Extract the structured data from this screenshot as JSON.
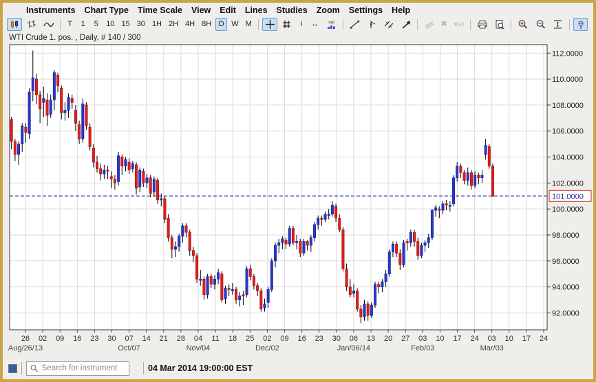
{
  "menubar": {
    "items": [
      "Instruments",
      "Chart Type",
      "Time Scale",
      "View",
      "Edit",
      "Lines",
      "Studies",
      "Zoom",
      "Settings",
      "Help"
    ]
  },
  "toolbar": {
    "timeframes": [
      {
        "label": "T",
        "selected": false
      },
      {
        "label": "1",
        "selected": false
      },
      {
        "label": "5",
        "selected": false
      },
      {
        "label": "10",
        "selected": false
      },
      {
        "label": "15",
        "selected": false
      },
      {
        "label": "30",
        "selected": false
      },
      {
        "label": "1H",
        "selected": false
      },
      {
        "label": "2H",
        "selected": false
      },
      {
        "label": "4H",
        "selected": false
      },
      {
        "label": "8H",
        "selected": false
      },
      {
        "label": "D",
        "selected": true
      },
      {
        "label": "W",
        "selected": false
      },
      {
        "label": "M",
        "selected": false
      }
    ],
    "info_label": "i",
    "expand_label": "↔",
    "vol_label": "vol",
    "delete_label": "✖",
    "delete_all_x": "✖",
    "delete_all_label": "all"
  },
  "title_bar": {
    "text": "WTI Crude 1. pos. , Daily, # 140 / 300"
  },
  "chart_data": {
    "type": "candlestick",
    "title": "WTI Crude 1. pos. , Daily, # 140 / 300",
    "ylim": [
      90.7,
      112.65
    ],
    "y_ticks": [
      92,
      94,
      96,
      98,
      100,
      102,
      104,
      106,
      108,
      110,
      112
    ],
    "y_tick_decimals": 4,
    "last_price": 101.0,
    "x_ticks": [
      "26",
      "02",
      "09",
      "16",
      "23",
      "30",
      "07",
      "14",
      "21",
      "28",
      "04",
      "11",
      "18",
      "25",
      "02",
      "09",
      "16",
      "23",
      "30",
      "06",
      "13",
      "20",
      "27",
      "03",
      "10",
      "17",
      "24",
      "03",
      "10",
      "17",
      "24"
    ],
    "month_labels": [
      {
        "label": "Aug/26/13",
        "tick": 0
      },
      {
        "label": "Oct/07",
        "tick": 6
      },
      {
        "label": "Nov/04",
        "tick": 10
      },
      {
        "label": "Dec/02",
        "tick": 14
      },
      {
        "label": "Jan/06/14",
        "tick": 19
      },
      {
        "label": "Feb/03",
        "tick": 23
      },
      {
        "label": "Mar/03",
        "tick": 27
      }
    ],
    "candle_fields": [
      "open",
      "high",
      "low",
      "close"
    ],
    "candles": [
      [
        106.9,
        107.1,
        104.6,
        105.2
      ],
      [
        105.2,
        105.4,
        103.7,
        104.2
      ],
      [
        104.2,
        105.2,
        103.4,
        105.0
      ],
      [
        105.0,
        106.6,
        104.4,
        106.4
      ],
      [
        106.3,
        106.6,
        105.1,
        105.9
      ],
      [
        105.8,
        109.3,
        105.4,
        109.0
      ],
      [
        109.1,
        112.2,
        108.3,
        110.1
      ],
      [
        110.0,
        110.4,
        108.1,
        108.8
      ],
      [
        108.8,
        109.1,
        106.6,
        107.7
      ],
      [
        108.2,
        109.4,
        107.1,
        108.5
      ],
      [
        108.4,
        108.9,
        106.4,
        107.2
      ],
      [
        107.3,
        108.8,
        107.0,
        108.4
      ],
      [
        108.4,
        110.7,
        107.6,
        110.5
      ],
      [
        110.3,
        110.5,
        109.0,
        109.5
      ],
      [
        109.3,
        109.5,
        106.9,
        107.4
      ],
      [
        107.4,
        108.2,
        106.8,
        107.6
      ],
      [
        107.6,
        108.9,
        107.0,
        108.6
      ],
      [
        108.5,
        108.8,
        107.7,
        108.2
      ],
      [
        107.6,
        108.0,
        106.0,
        106.6
      ],
      [
        106.5,
        106.8,
        105.0,
        105.4
      ],
      [
        105.4,
        108.5,
        105.1,
        108.1
      ],
      [
        108.0,
        108.2,
        106.1,
        106.4
      ],
      [
        106.3,
        106.6,
        104.5,
        104.8
      ],
      [
        104.7,
        105.0,
        103.2,
        103.6
      ],
      [
        103.6,
        104.1,
        102.8,
        103.1
      ],
      [
        103.1,
        103.5,
        102.2,
        102.7
      ],
      [
        102.7,
        103.4,
        102.3,
        103.0
      ],
      [
        103.0,
        103.3,
        102.3,
        102.9
      ],
      [
        102.5,
        102.9,
        101.6,
        102.3
      ],
      [
        102.3,
        102.6,
        101.5,
        102.0
      ],
      [
        102.1,
        104.4,
        101.8,
        104.1
      ],
      [
        104.0,
        104.2,
        102.6,
        103.3
      ],
      [
        103.3,
        104.0,
        102.9,
        103.8
      ],
      [
        103.6,
        103.9,
        102.7,
        103.0
      ],
      [
        103.1,
        103.7,
        102.8,
        103.5
      ],
      [
        103.4,
        103.6,
        101.1,
        101.6
      ],
      [
        101.7,
        103.2,
        101.3,
        103.0
      ],
      [
        102.9,
        103.1,
        101.7,
        102.0
      ],
      [
        102.0,
        102.7,
        101.6,
        102.4
      ],
      [
        102.4,
        102.6,
        100.9,
        101.2
      ],
      [
        101.3,
        102.5,
        101.0,
        102.3
      ],
      [
        102.2,
        102.4,
        100.4,
        100.7
      ],
      [
        100.7,
        101.2,
        100.2,
        100.8
      ],
      [
        100.8,
        101.0,
        98.9,
        99.2
      ],
      [
        99.3,
        99.6,
        97.5,
        97.8
      ],
      [
        97.8,
        98.0,
        96.2,
        96.9
      ],
      [
        96.9,
        97.5,
        96.3,
        97.1
      ],
      [
        97.1,
        98.1,
        96.7,
        97.9
      ],
      [
        97.9,
        98.9,
        97.4,
        98.7
      ],
      [
        98.7,
        98.9,
        97.8,
        98.2
      ],
      [
        98.2,
        98.4,
        96.4,
        96.8
      ],
      [
        96.8,
        97.1,
        95.9,
        96.4
      ],
      [
        96.4,
        96.6,
        94.3,
        94.6
      ],
      [
        94.5,
        95.3,
        94.1,
        94.6
      ],
      [
        94.6,
        94.8,
        93.0,
        93.4
      ],
      [
        93.4,
        95.0,
        93.1,
        94.8
      ],
      [
        94.8,
        95.0,
        93.9,
        94.2
      ],
      [
        94.2,
        94.9,
        93.8,
        94.6
      ],
      [
        94.6,
        95.4,
        94.2,
        95.1
      ],
      [
        95.0,
        95.2,
        92.8,
        93.0
      ],
      [
        93.1,
        94.1,
        92.7,
        93.9
      ],
      [
        93.9,
        94.2,
        93.3,
        93.8
      ],
      [
        93.7,
        94.3,
        93.4,
        93.8
      ],
      [
        93.8,
        94.0,
        92.7,
        93.0
      ],
      [
        93.0,
        93.6,
        92.5,
        93.3
      ],
      [
        93.4,
        93.7,
        92.6,
        93.3
      ],
      [
        93.4,
        95.6,
        93.2,
        95.4
      ],
      [
        95.4,
        95.7,
        94.5,
        94.8
      ],
      [
        94.8,
        95.0,
        93.8,
        94.1
      ],
      [
        94.1,
        94.3,
        93.3,
        93.7
      ],
      [
        93.7,
        93.9,
        92.1,
        92.3
      ],
      [
        92.4,
        93.1,
        92.1,
        92.7
      ],
      [
        92.8,
        94.0,
        92.4,
        93.8
      ],
      [
        93.8,
        96.2,
        93.6,
        96.0
      ],
      [
        96.0,
        97.4,
        95.5,
        97.2
      ],
      [
        97.2,
        97.7,
        96.6,
        97.4
      ],
      [
        97.4,
        97.9,
        96.9,
        97.7
      ],
      [
        97.6,
        97.8,
        96.9,
        97.3
      ],
      [
        97.3,
        98.7,
        97.1,
        98.5
      ],
      [
        98.5,
        98.7,
        97.2,
        97.4
      ],
      [
        97.4,
        98.0,
        96.9,
        97.5
      ],
      [
        97.5,
        97.7,
        96.3,
        96.6
      ],
      [
        96.6,
        97.7,
        96.4,
        97.5
      ],
      [
        97.5,
        97.6,
        96.8,
        97.2
      ],
      [
        97.2,
        98.0,
        96.7,
        97.8
      ],
      [
        97.8,
        99.0,
        97.5,
        98.8
      ],
      [
        98.8,
        99.5,
        98.4,
        99.3
      ],
      [
        99.3,
        99.5,
        98.7,
        99.2
      ],
      [
        99.2,
        99.8,
        99.0,
        99.6
      ],
      [
        99.5,
        100.0,
        99.2,
        99.6
      ],
      [
        99.6,
        100.6,
        99.4,
        100.3
      ],
      [
        100.2,
        100.4,
        99.0,
        99.3
      ],
      [
        99.3,
        99.6,
        98.2,
        98.4
      ],
      [
        98.4,
        98.6,
        95.2,
        95.4
      ],
      [
        95.4,
        95.8,
        93.7,
        94.0
      ],
      [
        94.0,
        94.6,
        93.2,
        93.4
      ],
      [
        93.5,
        94.2,
        93.2,
        93.7
      ],
      [
        93.7,
        93.9,
        92.1,
        92.3
      ],
      [
        92.3,
        92.6,
        91.2,
        91.7
      ],
      [
        91.7,
        93.0,
        91.4,
        92.7
      ],
      [
        92.7,
        92.9,
        91.4,
        91.8
      ],
      [
        91.8,
        92.8,
        91.6,
        92.6
      ],
      [
        92.6,
        94.4,
        92.4,
        94.2
      ],
      [
        94.2,
        94.4,
        93.5,
        94.0
      ],
      [
        94.0,
        94.6,
        93.6,
        94.4
      ],
      [
        94.4,
        95.3,
        94.0,
        95.0
      ],
      [
        95.0,
        96.9,
        94.8,
        96.7
      ],
      [
        96.7,
        97.5,
        96.3,
        97.3
      ],
      [
        97.3,
        97.5,
        96.3,
        96.6
      ],
      [
        96.6,
        96.9,
        95.3,
        95.7
      ],
      [
        95.7,
        97.6,
        95.5,
        97.4
      ],
      [
        97.5,
        97.7,
        96.8,
        97.4
      ],
      [
        97.4,
        98.4,
        97.1,
        98.2
      ],
      [
        98.2,
        98.4,
        97.1,
        97.5
      ],
      [
        97.5,
        97.8,
        96.1,
        96.4
      ],
      [
        96.4,
        97.4,
        96.2,
        97.2
      ],
      [
        97.2,
        97.6,
        96.7,
        97.4
      ],
      [
        97.4,
        98.1,
        97.0,
        97.8
      ],
      [
        97.8,
        100.0,
        97.6,
        99.9
      ],
      [
        99.9,
        100.3,
        99.4,
        100.1
      ],
      [
        100.0,
        100.2,
        99.3,
        99.9
      ],
      [
        99.9,
        100.6,
        99.6,
        100.4
      ],
      [
        100.4,
        100.7,
        99.9,
        100.3
      ],
      [
        100.2,
        100.6,
        99.8,
        100.3
      ],
      [
        100.4,
        102.6,
        100.2,
        102.4
      ],
      [
        102.4,
        103.6,
        102.1,
        103.3
      ],
      [
        103.3,
        103.5,
        102.4,
        102.8
      ],
      [
        102.8,
        103.0,
        101.9,
        102.2
      ],
      [
        102.2,
        103.2,
        101.8,
        102.8
      ],
      [
        102.8,
        103.0,
        101.5,
        101.8
      ],
      [
        101.8,
        102.9,
        101.6,
        102.6
      ],
      [
        102.6,
        102.8,
        101.9,
        102.4
      ],
      [
        102.4,
        103.0,
        102.0,
        102.6
      ],
      [
        104.2,
        105.4,
        103.8,
        104.9
      ],
      [
        104.8,
        105.0,
        103.1,
        103.3
      ],
      [
        103.3,
        103.5,
        100.9,
        101.0
      ]
    ]
  },
  "statusbar": {
    "search_placeholder": "Search for instrument",
    "timestamp": "04 Mar 2014 19:00:00 EST"
  },
  "colors": {
    "up_candle": "#2a38c8",
    "up_border": "#16209a",
    "down_candle": "#dd1f1f",
    "down_border": "#a40f0f",
    "wick": "#000000",
    "grid": "#dadada",
    "dashed_line": "#2233aa",
    "last_price_text": "#2222cc",
    "last_price_border": "#cc2222",
    "frame": "#cda349",
    "selected_button_bg": "#c9dff6"
  }
}
